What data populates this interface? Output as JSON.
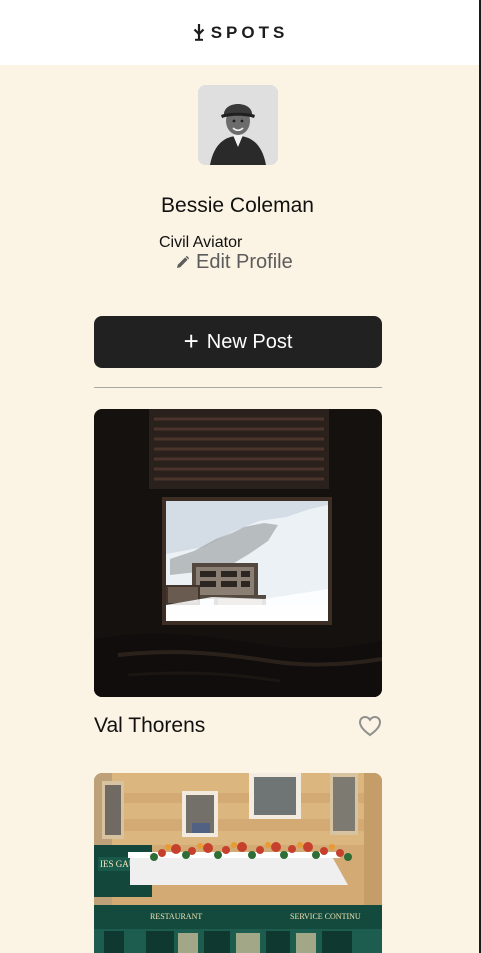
{
  "header": {
    "logo_text": "SPOTS"
  },
  "profile": {
    "name": "Bessie Coleman",
    "description": "Civil Aviator",
    "edit_label": "Edit Profile"
  },
  "actions": {
    "new_post_label": "New Post"
  },
  "cards": [
    {
      "title": "Val Thorens",
      "liked": false
    },
    {
      "title": "",
      "visible_image_text": [
        "IES GAUBERT",
        "RESTAURANT",
        "SERVICE CONTINU"
      ]
    }
  ],
  "colors": {
    "page_background": "#fbf3e3",
    "header_background": "#ffffff",
    "button_background": "#212121",
    "button_text": "#ffffff",
    "muted_text": "#5c5c5c"
  },
  "icons": {
    "logo": "fork-arrow-icon",
    "edit": "pencil-icon",
    "new_post": "plus-icon",
    "like": "heart-outline-icon"
  }
}
